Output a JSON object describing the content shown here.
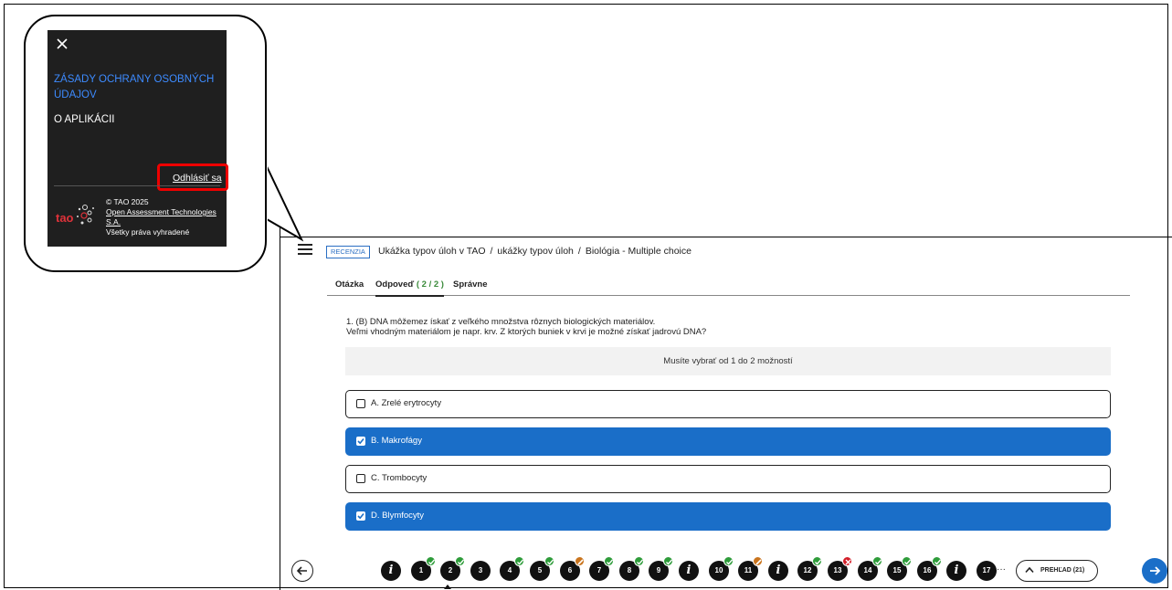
{
  "menu": {
    "close_icon": "close-icon",
    "privacy_label": "ZÁSADY OCHRANY OSOBNÝCH ÚDAJOV",
    "about_label": "O APLIKÁCII",
    "logout_label": "Odhlásiť sa",
    "copyright": "© TAO 2025",
    "company_line1": "Open Assessment Technologies",
    "company_line2": "S.A.",
    "rights": "Všetky práva vyhradené",
    "highlight_color": "#e00000"
  },
  "header": {
    "menu_icon": "hamburger-icon",
    "badge": "RECENZIA",
    "breadcrumb": [
      "Ukážka typov úloh v TAO",
      "ukážky typov úloh",
      "Biológia - Multiple choice"
    ],
    "separator": "/"
  },
  "tabs": [
    {
      "label": "Otázka",
      "count": ""
    },
    {
      "label": "Odpoveď",
      "count": "( 2 / 2 )"
    },
    {
      "label": "Správne",
      "count": ""
    }
  ],
  "question": {
    "line1": "1. (B) DNA môžemez ískať z veľkého množstva rôznych biologických materiálov.",
    "line2": "Veľmi vhodným materiálom je napr. krv. Z ktorých buniek v krvi je možné získať jadrovú DNA?",
    "hint": "Musíte vybrať od 1 do 2 možností"
  },
  "choices": [
    {
      "label": "A. Zrelé erytrocyty",
      "selected": false
    },
    {
      "label": "B. Makrofágy",
      "selected": true
    },
    {
      "label": "C. Trombocyty",
      "selected": false
    },
    {
      "label": "D. Blymfocyty",
      "selected": true
    }
  ],
  "navigation": {
    "items": [
      {
        "label": "i",
        "type": "info",
        "status": ""
      },
      {
        "label": "1",
        "type": "item",
        "status": "ok"
      },
      {
        "label": "2",
        "type": "item",
        "status": "ok"
      },
      {
        "label": "3",
        "type": "item",
        "status": ""
      },
      {
        "label": "4",
        "type": "item",
        "status": "ok"
      },
      {
        "label": "5",
        "type": "item",
        "status": "ok"
      },
      {
        "label": "6",
        "type": "item",
        "status": "partial"
      },
      {
        "label": "7",
        "type": "item",
        "status": "ok"
      },
      {
        "label": "8",
        "type": "item",
        "status": "ok"
      },
      {
        "label": "9",
        "type": "item",
        "status": "ok"
      },
      {
        "label": "i",
        "type": "info",
        "status": ""
      },
      {
        "label": "10",
        "type": "item",
        "status": "ok"
      },
      {
        "label": "11",
        "type": "item",
        "status": "partial"
      },
      {
        "label": "i",
        "type": "info",
        "status": ""
      },
      {
        "label": "12",
        "type": "item",
        "status": "ok"
      },
      {
        "label": "13",
        "type": "item",
        "status": "wrong"
      },
      {
        "label": "14",
        "type": "item",
        "status": "ok"
      },
      {
        "label": "15",
        "type": "item",
        "status": "ok"
      },
      {
        "label": "16",
        "type": "item",
        "status": "ok"
      },
      {
        "label": "i",
        "type": "info",
        "status": ""
      },
      {
        "label": "17",
        "type": "item",
        "status": ""
      }
    ],
    "current": "2",
    "ellipsis": "···",
    "overview_label": "PREHĽAD (21)",
    "prev_icon": "arrow-left-icon",
    "next_icon": "arrow-right-icon"
  },
  "colors": {
    "accent": "#1a6ec8",
    "ok": "#2e9c3a",
    "partial": "#c9741d",
    "wrong": "#d3202a",
    "link": "#3d8bff"
  }
}
